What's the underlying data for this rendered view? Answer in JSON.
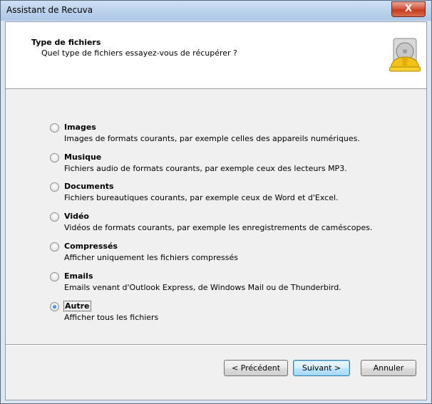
{
  "window": {
    "title": "Assistant de Recuva",
    "close_symbol": "X"
  },
  "header": {
    "title": "Type de fichiers",
    "subtitle": "Quel type de fichiers essayez-vous de récupérer ?",
    "icon": "recuva-hardhat-icon"
  },
  "options": [
    {
      "label": "Images",
      "description": "Images de formats courants, par exemple celles des appareils numériques.",
      "checked": false
    },
    {
      "label": "Musique",
      "description": "Fichiers audio de formats courants, par exemple ceux des lecteurs MP3.",
      "checked": false
    },
    {
      "label": "Documents",
      "description": "Fichiers bureautiques courants, par exemple ceux de Word et d'Excel.",
      "checked": false
    },
    {
      "label": "Vidéo",
      "description": "Vidéos de formats courants, par exemple les enregistrements de caméscopes.",
      "checked": false
    },
    {
      "label": "Compressés",
      "description": "Afficher uniquement les fichiers compressés",
      "checked": false
    },
    {
      "label": "Emails",
      "description": "Emails venant d'Outlook Express, de Windows Mail ou de Thunderbird.",
      "checked": false
    },
    {
      "label": "Autre",
      "description": "Afficher tous les fichiers",
      "checked": true
    }
  ],
  "buttons": {
    "previous": "< Précédent",
    "next": "Suivant >",
    "cancel": "Annuler"
  },
  "colors": {
    "accent": "#3c7fb1",
    "close": "#c43c20",
    "titlebar": "#bad1ec"
  }
}
